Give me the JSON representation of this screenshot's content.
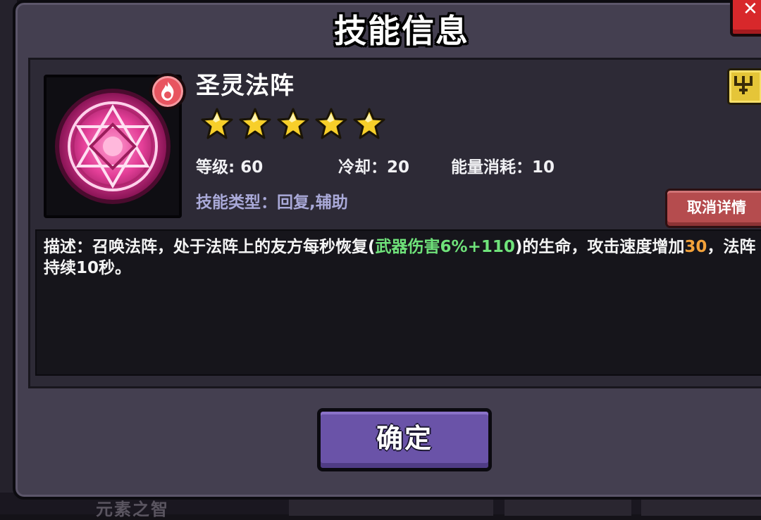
{
  "dialog": {
    "title": "技能信息"
  },
  "skill": {
    "name": "圣灵法阵",
    "stars": 5,
    "level_label": "等级: 60",
    "cooldown_label": "冷却：20",
    "energy_label": "能量消耗：10",
    "type_label": "技能类型：回复,辅助",
    "icon_name": "holy-magic-circle-icon",
    "badge_icon_name": "fire-element-badge-icon",
    "rank_icon_name": "trident-rank-icon"
  },
  "description": {
    "part1": "描述：召唤法阵，处于法阵上的友方每秒恢复(",
    "green": "武器伤害6%+110",
    "part2": ")的生命，攻击速度增加",
    "orange": "30",
    "part3": "，法阵持续10秒。"
  },
  "buttons": {
    "cancel_detail": "取消详情",
    "confirm": "确定"
  },
  "background": {
    "bottom_text": "元素之智"
  },
  "colors": {
    "dialog_bg": "#443f50",
    "panel_bg": "#2d2a36",
    "highlight_green": "#6fe27a",
    "highlight_orange": "#f2a13a",
    "star": "#f7cf2a",
    "confirm_button": "#6a53a8",
    "close_button": "#d8282b",
    "cancel_button": "#b54c4e"
  }
}
